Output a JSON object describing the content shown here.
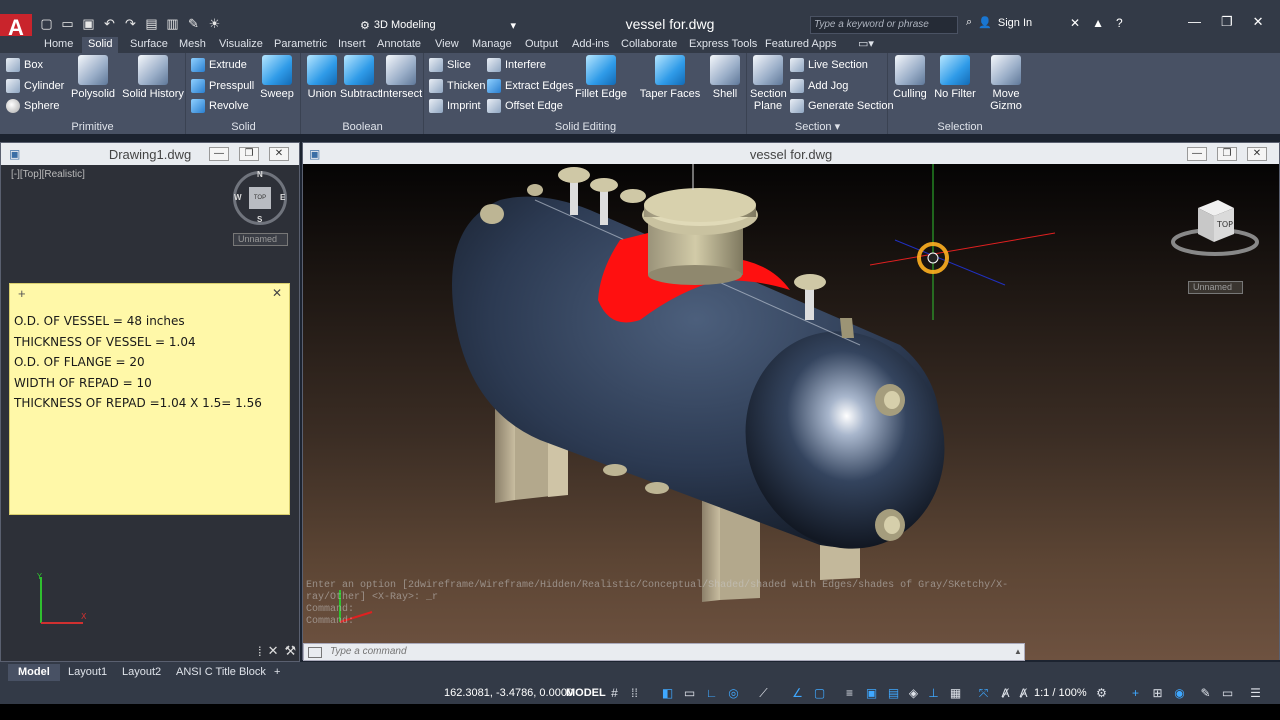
{
  "app": {
    "logo": "A",
    "document_title": "vessel for.dwg",
    "workspace": "3D Modeling",
    "search_placeholder": "Type a keyword or phrase",
    "sign_in": "Sign In"
  },
  "ribbon_tabs": [
    "Home",
    "Solid",
    "Surface",
    "Mesh",
    "Visualize",
    "Parametric",
    "Insert",
    "Annotate",
    "View",
    "Manage",
    "Output",
    "Add-ins",
    "Collaborate",
    "Express Tools",
    "Featured Apps"
  ],
  "active_tab": "Solid",
  "panels": {
    "primitive": {
      "title": "Primitive",
      "box": "Box",
      "cylinder": "Cylinder",
      "sphere": "Sphere",
      "polysolid": "Polysolid",
      "solid_history": "Solid History"
    },
    "solid": {
      "title": "Solid",
      "extrude": "Extrude",
      "presspull": "Presspull",
      "revolve": "Revolve",
      "sweep": "Sweep"
    },
    "boolean": {
      "title": "Boolean",
      "union": "Union",
      "subtract": "Subtract",
      "intersect": "Intersect"
    },
    "solid_editing": {
      "title": "Solid Editing",
      "slice": "Slice",
      "thicken": "Thicken",
      "imprint": "Imprint",
      "interfere": "Interfere",
      "extract_edges": "Extract Edges",
      "offset_edge": "Offset Edge",
      "fillet_edge": "Fillet Edge",
      "taper_faces": "Taper Faces",
      "shell": "Shell"
    },
    "section": {
      "title": "Section",
      "section_plane_1": "Section",
      "section_plane_2": "Plane",
      "live_section": "Live Section",
      "add_jog": "Add Jog",
      "generate_section": "Generate Section"
    },
    "selection": {
      "title": "Selection",
      "culling": "Culling",
      "no_filter": "No Filter",
      "move_gizmo_1": "Move",
      "move_gizmo_2": "Gizmo"
    }
  },
  "drawing1": {
    "title": "Drawing1.dwg",
    "view_label": "[-][Top][Realistic]",
    "unnamed": "Unnamed",
    "compass": {
      "n": "N",
      "s": "S",
      "e": "E",
      "w": "W",
      "top": "TOP"
    }
  },
  "note": {
    "lines": [
      "O.D. OF VESSEL = 48 inches",
      "THICKNESS OF VESSEL = 1.04",
      "O.D. OF FLANGE = 20",
      "WIDTH OF REPAD = 10",
      "THICKNESS OF REPAD =1.04 X 1.5= 1.56"
    ]
  },
  "viewport": {
    "title": "vessel for.dwg",
    "viewcube_top": "TOP",
    "unnamed": "Unnamed"
  },
  "command": {
    "history": [
      "Enter an option [2dwireframe/Wireframe/Hidden/Realistic/Conceptual/Shaded/shaded with Edges/shades of Gray/SKetchy/X-",
      "ray/Other] <X-Ray>: _r",
      "Command:",
      "Command:"
    ],
    "placeholder": "Type a command"
  },
  "layout_tabs": [
    "Model",
    "Layout1",
    "Layout2",
    "ANSI C Title Block"
  ],
  "status": {
    "coordinates": "162.3081, -3.4786, 0.0000",
    "model": "MODEL",
    "scale": "1:1 / 100%"
  },
  "colors": {
    "accent_red": "#c9242c",
    "ribbon_bg": "#485164",
    "vessel_body": "#2e3d55",
    "repad_red": "#ff1010",
    "nozzle_tan": "#b8b08e",
    "note_yellow": "#fff8a8"
  }
}
